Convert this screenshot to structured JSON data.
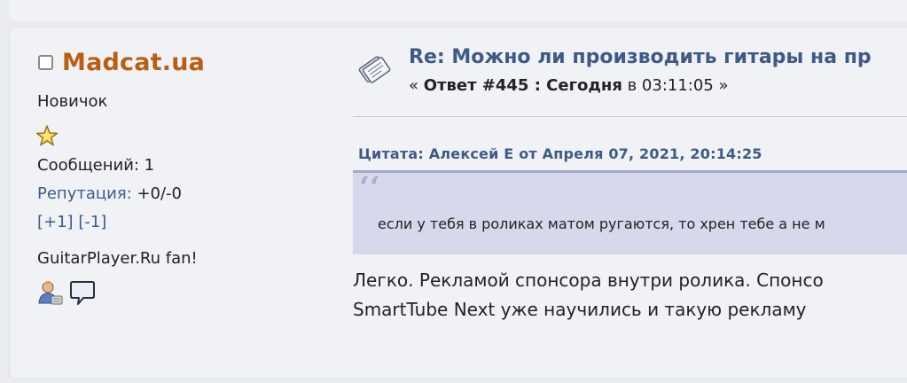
{
  "poster": {
    "name": "Madcat.ua",
    "rank": "Новичок",
    "posts": "Сообщений: 1",
    "reputation_label": "Репутация:",
    "reputation_value": " +0/-0",
    "rep_plus": "[+1]",
    "rep_minus": "[-1]",
    "signature_line": "GuitarPlayer.Ru fan!",
    "icons": [
      "star-icon",
      "profile-icon",
      "message-icon"
    ]
  },
  "post": {
    "subject": "Re: Можно ли производить гитары на пр",
    "meta_open": "« ",
    "meta_reply": "Ответ #445 : Сегодня",
    "meta_at": " в 03:11:05 »",
    "quote_header": "Цитата: Алексей Е от Апреля 07, 2021, 20:14:25",
    "quote_mark": "‘‘",
    "quote_text": "если у тебя в роликах матом ругаются, то хрен тебе а не м",
    "body_line1": "Легко. Рекламой спонсора внутри ролика. Спонсо",
    "body_line2": "SmartTube Next уже научились и такую рекламу "
  },
  "colors": {
    "name": "#b95e12",
    "link": "#3e5a87",
    "quote_bg": "#d6d9eb",
    "post_bg": "#f0f2f5"
  }
}
